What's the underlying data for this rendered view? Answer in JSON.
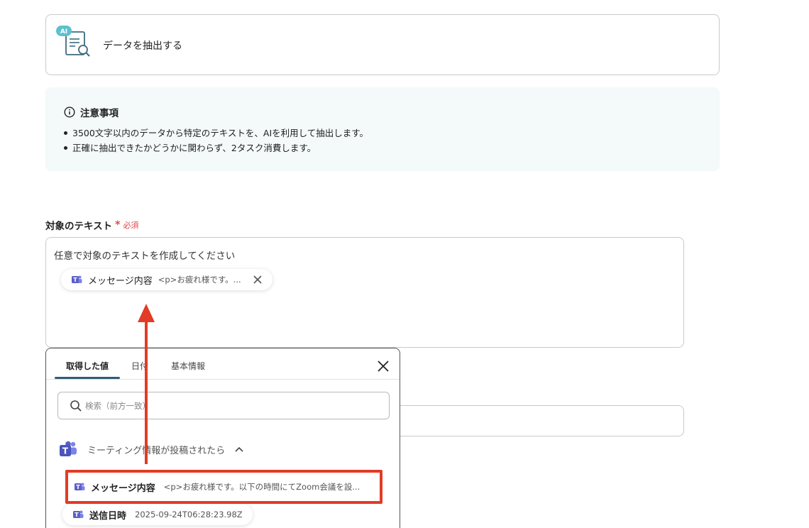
{
  "action": {
    "ai_badge": "AI",
    "label": "データを抽出する"
  },
  "notice": {
    "title": "注意事項",
    "items": [
      "3500文字以内のデータから特定のテキストを、AIを利用して抽出します。",
      "正確に抽出できたかどうかに関わらず、2タスク消費します。"
    ]
  },
  "target_text": {
    "label": "対象のテキスト",
    "required_star": "*",
    "required_text": "必須",
    "value": "任意で対象のテキストを作成してください",
    "chip": {
      "name": "メッセージ内容",
      "value": "<p>お疲れ様です。..."
    }
  },
  "dropdown": {
    "tabs": [
      "取得した値",
      "日付",
      "基本情報"
    ],
    "search_placeholder": "検索（前方一致）",
    "group_title": "ミーティング情報が投稿されたら",
    "items": [
      {
        "name": "メッセージ内容",
        "value": "<p>お疲れ様です。以下の時間にてZoom会議を設..."
      },
      {
        "name": "送信日時",
        "value": "2025-09-24T06:28:23.98Z"
      }
    ]
  },
  "colors": {
    "accent": "#2e5f72",
    "required": "#e04848",
    "highlight": "#e23b26",
    "teams": "#5b5fc7"
  }
}
